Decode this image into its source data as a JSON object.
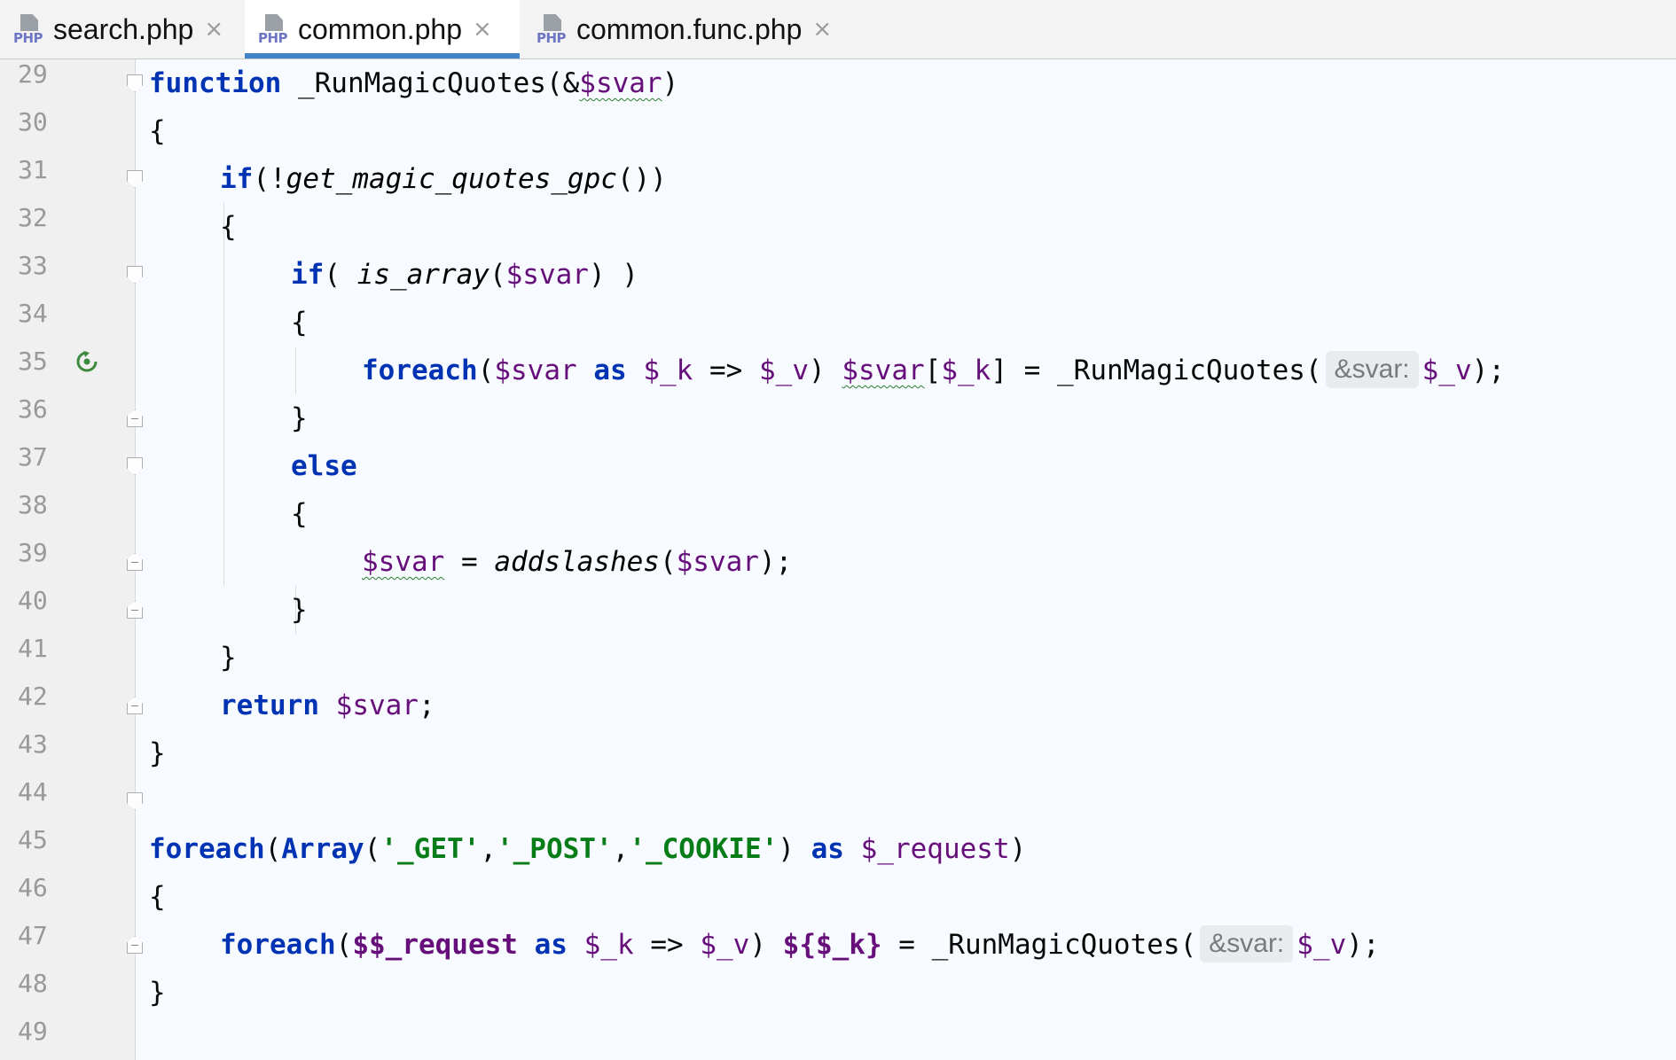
{
  "tabs": [
    {
      "label": "search.php",
      "icon": "php-file-icon",
      "icon_text": "PHP",
      "active": false
    },
    {
      "label": "common.php",
      "icon": "php-file-icon",
      "icon_text": "PHP",
      "active": true
    },
    {
      "label": "common.func.php",
      "icon": "php-file-icon",
      "icon_text": "PHP",
      "active": false
    }
  ],
  "close_glyph": "×",
  "line_numbers": [
    "29",
    "30",
    "31",
    "32",
    "33",
    "34",
    "35",
    "36",
    "37",
    "38",
    "39",
    "40",
    "41",
    "42",
    "43",
    "44",
    "45",
    "46",
    "47",
    "48",
    "49"
  ],
  "gutter_icons": {
    "line_35": "recursion-icon"
  },
  "colors": {
    "keyword": "#0033b3",
    "variable": "#660e7a",
    "string": "#067d17",
    "active_tab_underline": "#4083c9",
    "editor_background": "#f7faff",
    "gutter_background": "#f0f0f0"
  },
  "code": {
    "l29": {
      "kw": "function",
      "name": "_RunMagicQuotes",
      "open": "(&",
      "param": "$svar",
      "close": ")"
    },
    "l30": {
      "text": "{"
    },
    "l31": {
      "kw": "if",
      "a": "(!",
      "fn": "get_magic_quotes_gpc",
      "b": "())"
    },
    "l32": {
      "text": "{"
    },
    "l33": {
      "kw": "if",
      "a": "( ",
      "fn": "is_array",
      "b": "(",
      "v1": "$svar",
      "c": ") )"
    },
    "l34": {
      "text": "{"
    },
    "l35": {
      "kw1": "foreach",
      "a": "(",
      "v1": "$svar",
      "kw2": "as",
      "v2": "$_k",
      "arrow": "=>",
      "v3": "$_v",
      "b": ")",
      "v4": "$svar",
      "c": "[",
      "v5": "$_k",
      "d": "] = _RunMagicQuotes(",
      "hint": "&svar:",
      "v6": "$_v",
      "e": ");"
    },
    "l36": {
      "text": "}"
    },
    "l37": {
      "kw": "else"
    },
    "l38": {
      "text": "{"
    },
    "l39": {
      "v1": "$svar",
      "a": " = ",
      "fn": "addslashes",
      "b": "(",
      "v2": "$svar",
      "c": ");"
    },
    "l40": {
      "text": "}"
    },
    "l41": {
      "text": "}"
    },
    "l42": {
      "kw": "return",
      "v1": "$svar",
      "a": ";"
    },
    "l43": {
      "text": "}"
    },
    "l45": {
      "kw1": "foreach",
      "a": "(",
      "kw2": "Array",
      "b": "(",
      "s1": "'_GET'",
      "c1": ",",
      "s2": "'_POST'",
      "c2": ",",
      "s3": "'_COOKIE'",
      "d": ")",
      "kw3": "as",
      "v1": "$_request",
      "e": ")"
    },
    "l46": {
      "text": "{"
    },
    "l47": {
      "kw1": "foreach",
      "a": "(",
      "v1": "$$_request",
      "kw2": "as",
      "v2": "$_k",
      "arrow": "=>",
      "v3": "$_v",
      "b": ")",
      "v4": "${$_k}",
      "c": " = _RunMagicQuotes(",
      "hint": "&svar:",
      "v5": "$_v",
      "d": ");"
    },
    "l48": {
      "text": "}"
    }
  }
}
